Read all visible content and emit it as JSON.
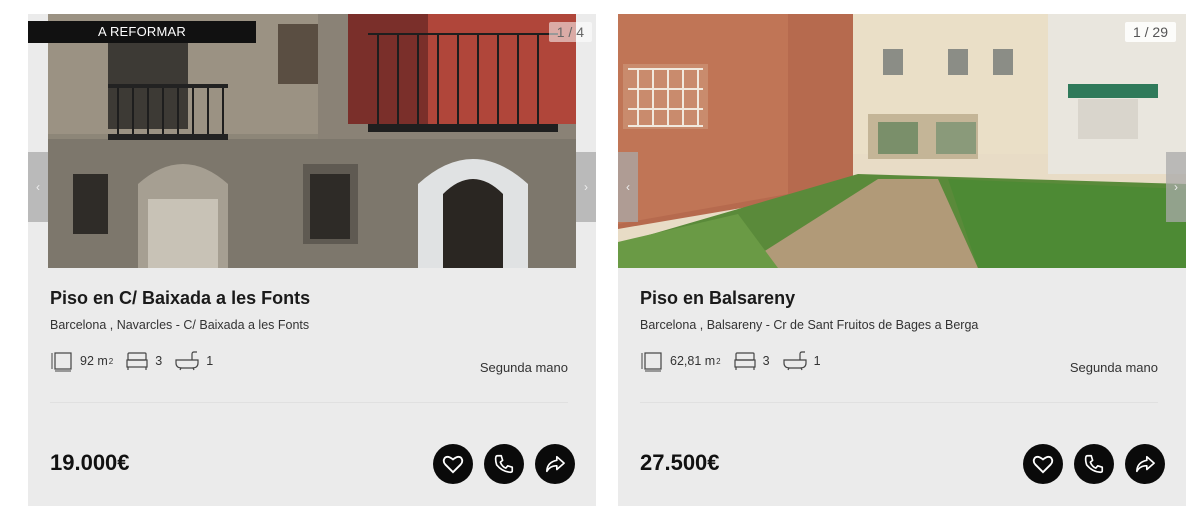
{
  "listings": [
    {
      "badge": "A REFORMAR",
      "photo_counter": "1 / 4",
      "title": "Piso en C/ Baixada a les Fonts",
      "location": "Barcelona , Navarcles - C/ Baixada a les Fonts",
      "area_value": "92 m",
      "area_unit_sup": "2",
      "bedrooms": "3",
      "bathrooms": "1",
      "condition": "Segunda mano",
      "price": "19.000€"
    },
    {
      "photo_counter": "1 / 29",
      "title": "Piso en Balsareny",
      "location": "Barcelona , Balsareny - Cr de Sant Fruitos de Bages a Berga",
      "area_value": "62,81 m",
      "area_unit_sup": "2",
      "bedrooms": "3",
      "bathrooms": "1",
      "condition": "Segunda mano",
      "price": "27.500€"
    }
  ],
  "icons": {
    "area": "area-icon",
    "bed": "bed-icon",
    "bath": "bath-icon",
    "favorite": "heart-icon",
    "call": "phone-icon",
    "share": "share-icon",
    "prev": "chevron-left-icon",
    "next": "chevron-right-icon"
  },
  "arrows": {
    "prev": "‹",
    "next": "›"
  },
  "colors": {
    "card_bg": "#ebebeb",
    "button_bg": "#0a0a0a",
    "badge_bg": "#111111"
  }
}
